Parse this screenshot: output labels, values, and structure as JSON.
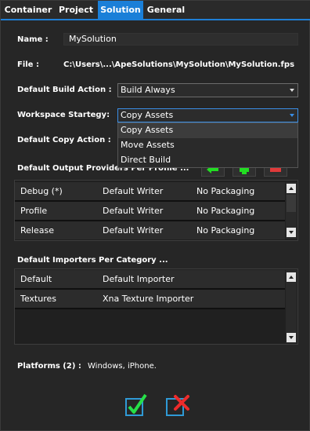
{
  "tabs": [
    {
      "label": "Container"
    },
    {
      "label": "Project"
    },
    {
      "label": "Solution"
    },
    {
      "label": "General"
    }
  ],
  "active_tab_index": 2,
  "form": {
    "name_label": "Name :",
    "name_value": "MySolution",
    "file_label": "File :",
    "file_value": "C:\\Users\\...\\ApeSolutions\\MySolution\\MySolution.fps",
    "build_action_label": "Default Build Action :",
    "build_action_value": "Build Always",
    "workspace_label": "Workspace Startegy:",
    "workspace_value": "Copy Assets",
    "workspace_options": [
      "Copy Assets",
      "Move Assets",
      "Direct Build"
    ],
    "copy_action_label": "Default Copy Action :"
  },
  "output_providers": {
    "heading": "Default Output Providers Per Profile ...",
    "rows": [
      {
        "profile": "Debug (*)",
        "writer": "Default Writer",
        "packaging": "No Packaging"
      },
      {
        "profile": "Profile",
        "writer": "Default Writer",
        "packaging": "No Packaging"
      },
      {
        "profile": "Release",
        "writer": "Default Writer",
        "packaging": "No Packaging"
      }
    ]
  },
  "importers": {
    "heading": "Default Importers Per Category ...",
    "rows": [
      {
        "category": "Default",
        "importer": "Default Importer"
      },
      {
        "category": "Textures",
        "importer": "Xna Texture Importer"
      }
    ]
  },
  "platforms": {
    "label": "Platforms (2) :",
    "value": "Windows, iPhone."
  },
  "colors": {
    "accent": "#1a7fd8",
    "add_green": "#22dd22",
    "remove_red": "#e03a3a",
    "ok_green": "#27e048",
    "cancel_red": "#ee2b2b",
    "check_blue": "#2f9ad6"
  },
  "icons": {
    "copy": "arrow-left-icon",
    "add": "plus-icon",
    "remove": "minus-icon",
    "ok": "checkbox-check-icon",
    "cancel": "checkbox-x-icon"
  }
}
